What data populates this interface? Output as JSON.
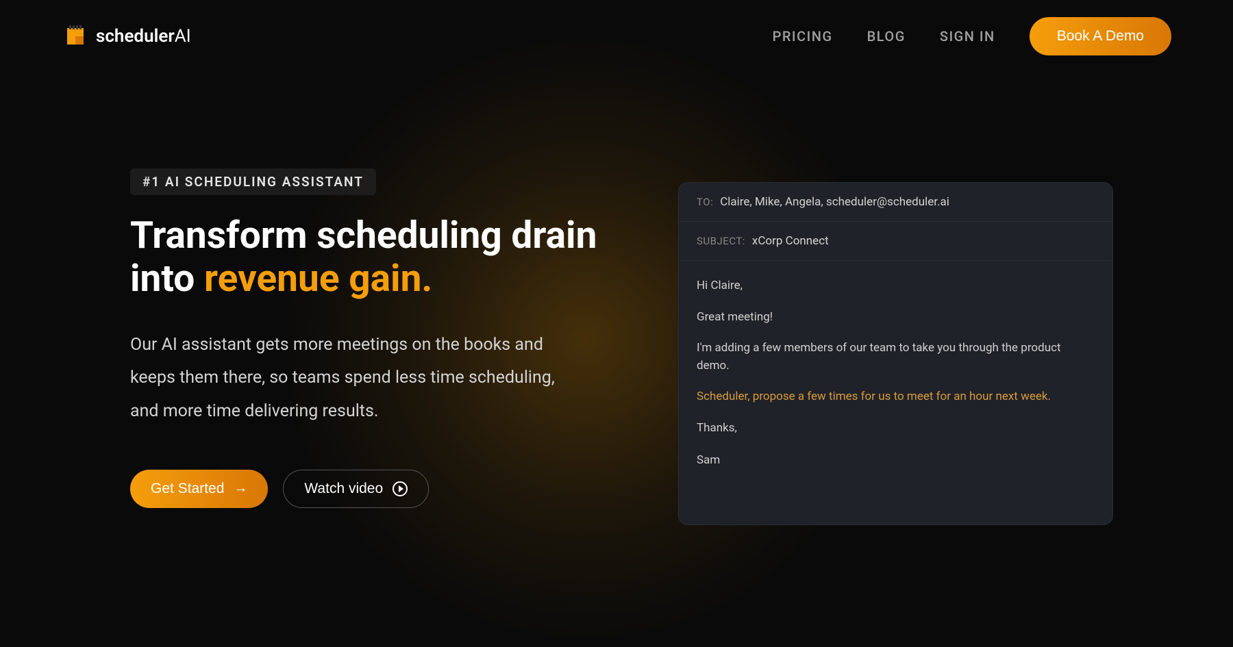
{
  "logo": {
    "brand_prefix": "scheduler",
    "brand_suffix": "AI"
  },
  "nav": {
    "pricing": "PRICING",
    "blog": "BLOG",
    "signin": "SIGN IN",
    "cta": "Book A Demo"
  },
  "hero": {
    "tag": "#1 AI SCHEDULING ASSISTANT",
    "headline_plain": "Transform scheduling drain into ",
    "headline_highlight": "revenue gain.",
    "subhead": "Our AI assistant gets more meetings on the books and keeps them there, so teams spend less time scheduling, and more time delivering results.",
    "get_started": "Get Started",
    "watch_video": "Watch video"
  },
  "email": {
    "to_label": "TO:",
    "to_value": "Claire, Mike, Angela, scheduler@scheduler.ai",
    "subject_label": "SUBJECT:",
    "subject_value": "xCorp Connect",
    "body_lines": [
      "Hi Claire,",
      "Great meeting!",
      "I'm adding a few members of our team to take you through the product demo.",
      "Scheduler, propose a few times for us to meet for an hour next week.",
      "Thanks,",
      "Sam"
    ],
    "command_index": 3
  },
  "colors": {
    "accent": "#f59e0b"
  }
}
